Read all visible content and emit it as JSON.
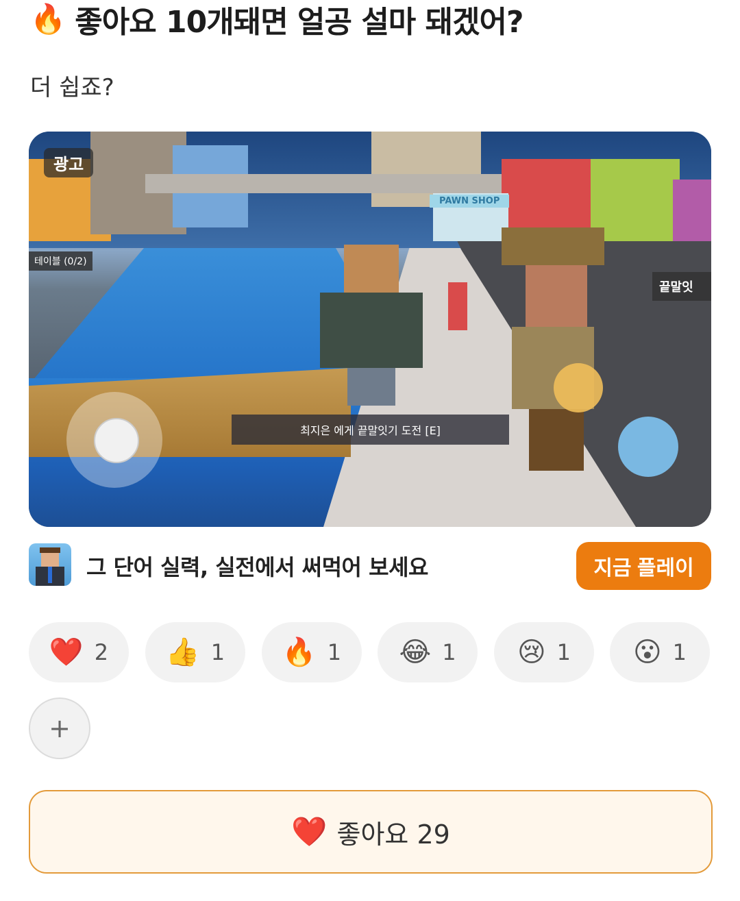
{
  "post": {
    "title_icon": "🔥",
    "title": "좋아요 10개돼면 얼공 설마 돼겠어?",
    "body": "더 쉽죠?"
  },
  "ad": {
    "badge": "광고",
    "prompt_text": "최지은 에게 끝말잇기 도전 [E]",
    "sign_left": "테이블 (0/2)",
    "sign_right": "끝말잇",
    "shop_sign": "PAWN SHOP",
    "cta_text": "그 단어 실력, 실전에서 써먹어 보세요",
    "cta_button": "지금 플레이"
  },
  "reactions": [
    {
      "emoji": "❤️",
      "name": "heart",
      "count": "2"
    },
    {
      "emoji": "👍",
      "name": "thumbs-up",
      "count": "1"
    },
    {
      "emoji": "🔥",
      "name": "fire",
      "count": "1"
    },
    {
      "emoji": "😂",
      "name": "laughing",
      "count": "1"
    },
    {
      "emoji": "😢",
      "name": "crying",
      "count": "1"
    },
    {
      "emoji": "😮",
      "name": "surprised",
      "count": "1"
    }
  ],
  "add_reaction_label": "+",
  "like": {
    "emoji": "❤️",
    "label": "좋아요 29"
  },
  "colors": {
    "accent": "#ec7c0f",
    "like_border": "#e39a3a",
    "like_bg": "#fff7ec",
    "chip_bg": "#f2f2f2"
  }
}
